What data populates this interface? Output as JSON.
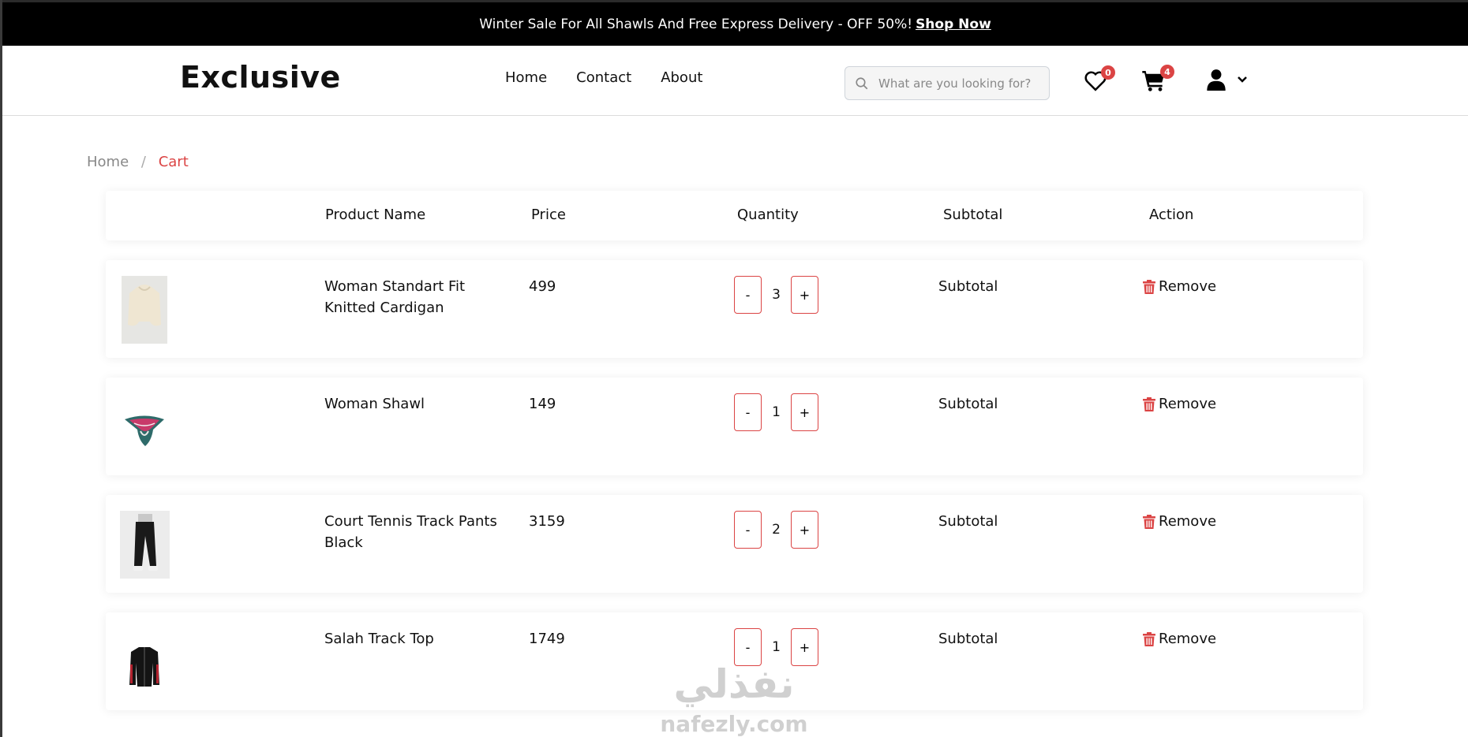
{
  "announcement": {
    "text": "Winter Sale For All Shawls And Free Express Delivery - OFF 50%!",
    "link": "Shop Now"
  },
  "header": {
    "logo": "Exclusive",
    "nav": [
      "Home",
      "Contact",
      "About"
    ],
    "search_placeholder": "What are you looking for?",
    "wishlist_count": "0",
    "cart_count": "4"
  },
  "breadcrumb": {
    "home": "Home",
    "separator": "/",
    "current": "Cart"
  },
  "table": {
    "headers": {
      "name": "Product Name",
      "price": "Price",
      "quantity": "Quantity",
      "subtotal": "Subtotal",
      "action": "Action"
    },
    "rows": [
      {
        "name": "Woman Standart Fit Knitted Cardigan",
        "price": "499",
        "qty": "3",
        "subtotal": "Subtotal",
        "minus": "-",
        "plus": "+",
        "remove": "Remove"
      },
      {
        "name": "Woman Shawl",
        "price": "149",
        "qty": "1",
        "subtotal": "Subtotal",
        "minus": "-",
        "plus": "+",
        "remove": "Remove"
      },
      {
        "name": "Court Tennis Track Pants Black",
        "price": "3159",
        "qty": "2",
        "subtotal": "Subtotal",
        "minus": "-",
        "plus": "+",
        "remove": "Remove"
      },
      {
        "name": "Salah Track Top",
        "price": "1749",
        "qty": "1",
        "subtotal": "Subtotal",
        "minus": "-",
        "plus": "+",
        "remove": "Remove"
      }
    ]
  },
  "watermark": {
    "arabic": "نفذلي",
    "latin": "nafezly.com"
  },
  "colors": {
    "accent": "#db4444",
    "topbar": "#000000"
  }
}
